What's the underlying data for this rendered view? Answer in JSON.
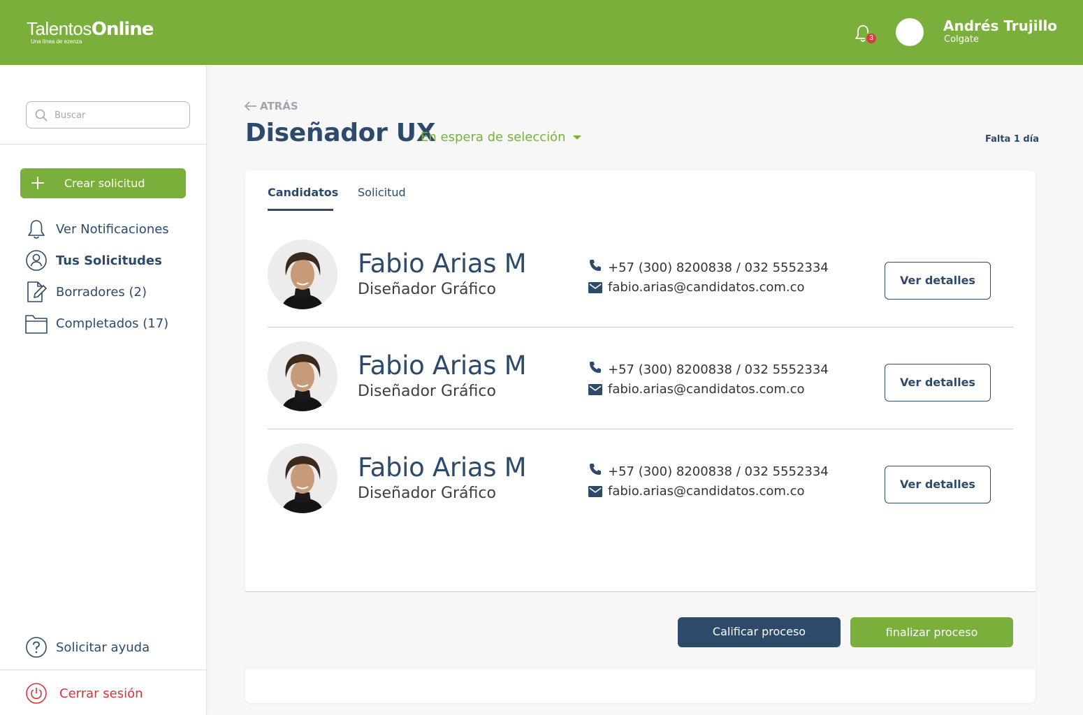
{
  "colors": {
    "brand_green": "#7aaf3b",
    "navy": "#2d4a6b",
    "danger": "#d8333a",
    "badge": "#e03a3e"
  },
  "header": {
    "logo_text_1": "Talentos",
    "logo_text_2": "Online",
    "logo_sub": "Una línea de ezenza",
    "notification_count": "3",
    "user_name": "Andrés Trujillo",
    "user_company": "Colgate"
  },
  "sidebar": {
    "search_placeholder": "Buscar",
    "create_label": "Crear solicitud",
    "items": [
      {
        "label": "Ver Notificaciones",
        "icon": "bell-icon"
      },
      {
        "label": "Tus Solicitudes",
        "icon": "user-circle-icon",
        "active": true
      },
      {
        "label": "Borradores (2)",
        "icon": "document-edit-icon"
      },
      {
        "label": "Completados (17)",
        "icon": "folder-icon"
      }
    ],
    "help_label": "Solicitar ayuda",
    "logout_label": "Cerrar sesión"
  },
  "main": {
    "back_label": "ATRÁS",
    "title": "Diseñador UX",
    "status": "En espera de selección",
    "deadline": "Falta 1 día",
    "tabs": [
      {
        "label": "Candidatos",
        "active": true
      },
      {
        "label": "Solicitud",
        "active": false
      }
    ],
    "candidates": [
      {
        "name": "Fabio Arias M",
        "role": "Diseñador Gráfico",
        "phone": "+57 (300) 8200838 / 032 5552334",
        "email": "fabio.arias@candidatos.com.co",
        "action": "Ver detalles"
      },
      {
        "name": "Fabio Arias M",
        "role": "Diseñador Gráfico",
        "phone": "+57 (300) 8200838 / 032 5552334",
        "email": "fabio.arias@candidatos.com.co",
        "action": "Ver detalles"
      },
      {
        "name": "Fabio Arias M",
        "role": "Diseñador Gráfico",
        "phone": "+57 (300) 8200838 / 032 5552334",
        "email": "fabio.arias@candidatos.com.co",
        "action": "Ver detalles"
      }
    ],
    "rate_label": "Calificar proceso",
    "finish_label": "finalizar proceso"
  }
}
